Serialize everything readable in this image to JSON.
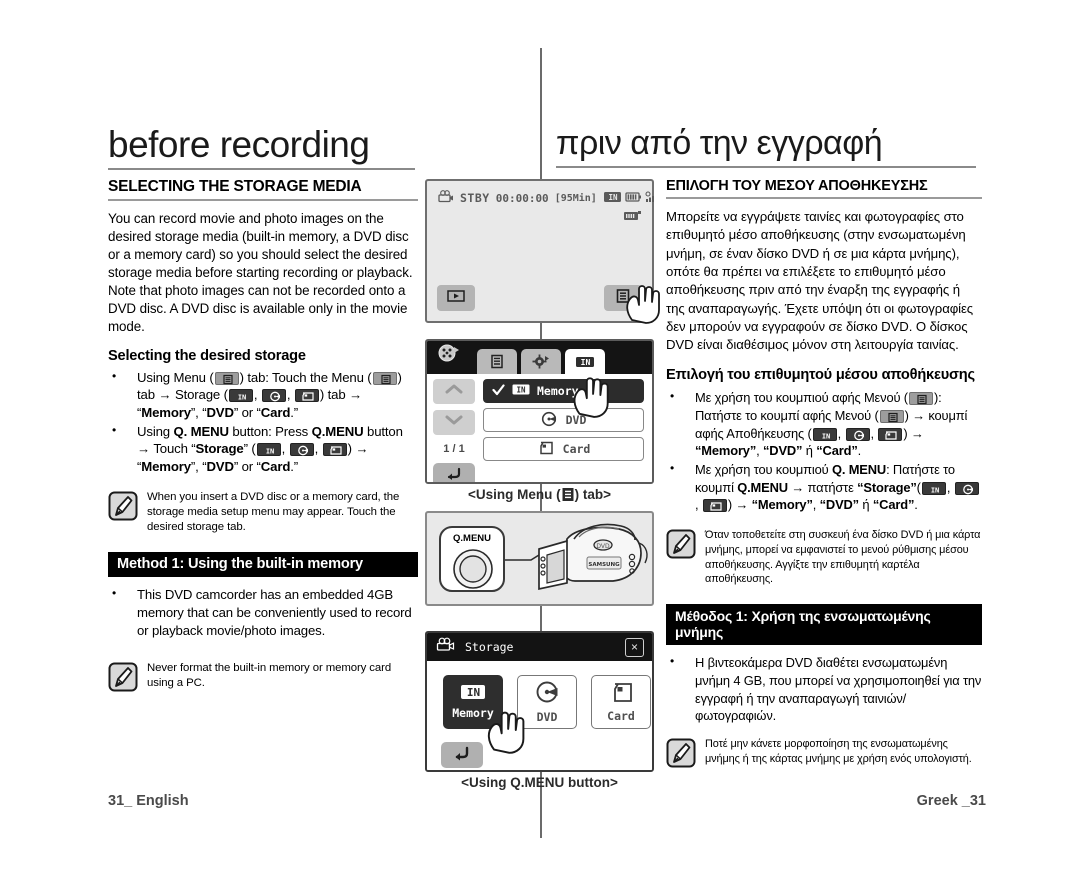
{
  "page": {
    "title_en": "before recording",
    "title_el": "πριν από την εγγραφή",
    "footer_left": "31_ English",
    "footer_right": "Greek _31"
  },
  "english": {
    "section_heading": "SELECTING THE STORAGE MEDIA",
    "intro": "You can record movie and photo images on the desired storage media (built-in memory, a DVD disc or a memory card) so you should select the desired storage media before starting recording or playback. Note that photo images can not be recorded onto a DVD disc. A DVD disc is available only in the movie mode.",
    "sub_heading": "Selecting the desired storage",
    "bullet1": {
      "p1": "Using Menu (",
      "p2": ") tab: Touch the Menu (",
      "p3": ") tab → Storage (",
      "p4": ") tab → “",
      "b_memory": "Memory",
      "p5": "”, “",
      "b_dvd": "DVD",
      "p6": "” or “",
      "b_card": "Card",
      "p7": ".”"
    },
    "bullet2": {
      "p1": "Using ",
      "b_qmenu1": "Q. MENU",
      "p2": " button: Press ",
      "b_qmenu2": "Q.MENU",
      "p3": " button → Touch “",
      "b_storage": "Storage",
      "p4": "” (",
      "p5": ") → “",
      "b_memory": "Memory",
      "p6": "”, “",
      "b_dvd": "DVD",
      "p7": "” or “",
      "b_card": "Card",
      "p8": ".”"
    },
    "note1": "When you insert a DVD disc or a memory card, the storage media setup menu may appear. Touch the desired storage tab.",
    "method_bar": "Method 1: Using the built-in memory",
    "method_bullet": "This DVD camcorder has an embedded 4GB memory that can be conveniently used to record or playback movie/photo images.",
    "note2": "Never format the built-in memory or memory card using a PC."
  },
  "greek": {
    "section_heading": "ΕΠΙΛΟΓΗ ΤΟΥ ΜΕΣΟΥ ΑΠΟΘΗΚΕΥΣΗΣ",
    "intro": "Μπορείτε να εγγράψετε ταινίες και φωτογραφίες στο επιθυμητό μέσο αποθήκευσης (στην ενσωματωμένη μνήμη, σε έναν δίσκο DVD ή σε μια κάρτα μνήμης), οπότε θα πρέπει να επιλέξετε το επιθυμητό μέσο αποθήκευσης πριν από την έναρξη της εγγραφής ή της αναπαραγωγής. Έχετε υπόψη ότι οι φωτογραφίες δεν μπορούν να εγγραφούν σε δίσκο DVD. Ο δίσκος DVD είναι διαθέσιμος μόνον στη λειτουργία ταινίας.",
    "sub_heading": "Επιλογή του επιθυμητού μέσου αποθήκευσης",
    "bullet1": {
      "p1": "Με χρήση του κουμπιού αφής Μενού (",
      "p2": "): Πατήστε το κουμπί αφής Μενού (",
      "p3": ") → κουμπί αφής Αποθήκευσης (",
      "p4": ") → ",
      "b_memory": "“Memory”",
      "p5": ", ",
      "b_dvd": "“DVD”",
      "p6": " ή ",
      "b_card": "“Card”",
      "p7": "."
    },
    "bullet2": {
      "p1": "Με χρήση του κουμπιού ",
      "b_qmenu1": "Q. MENU",
      "p2": ": Πατήστε το κουμπί ",
      "b_qmenu2": "Q.MENU",
      "p3": " → πατήστε ",
      "b_storage": "“Storage”",
      "p4": "(",
      "p5": ") → ",
      "b_memory": "“Memory”",
      "p6": ", ",
      "b_dvd": "“DVD”",
      "p7": " ή ",
      "b_card": "“Card”",
      "p8": "."
    },
    "note1": "Όταν τοποθετείτε στη συσκευή ένα δίσκο DVD ή μια κάρτα μνήμης, μπορεί να εμφανιστεί το μενού ρύθμισης μέσου αποθήκευσης. Αγγίξτε την επιθυμητή καρτέλα αποθήκευσης.",
    "method_bar": "Μέθοδος 1: Χρήση της ενσωματωμένης μνήμης",
    "method_bullet": "Η βιντεοκάμερα DVD διαθέτει ενσωματωμένη μνήμη 4 GB, που μπορεί να χρησιμοποιηθεί για την εγγραφή ή την αναπαραγωγή ταινιών/ φωτογραφιών.",
    "note2": "Ποτέ μην κάνετε μορφοποίηση της ενσωματωμένης μνήμης ή της κάρτας μνήμης με χρήση ενός υπολογιστή."
  },
  "figures": {
    "lcd_standby": {
      "mode_icon": "movie-camera-icon",
      "status": "STBY",
      "timecode": "00:00:00",
      "remaining": "[95Min]",
      "storage_icon": "in-memory-icon",
      "battery_icon": "battery-icon",
      "signal_icon": "signal-icon",
      "tape_icon": "tape-icon",
      "play_button_icon": "play-icon",
      "menu_button_icon": "menu-icon"
    },
    "menu_panel": {
      "tabs": [
        "settings-logo-icon",
        "menu-tab-icon",
        "gear-tab-icon",
        "in-memory-tab-icon"
      ],
      "rows": [
        {
          "label": "Memory",
          "icon": "in-memory-icon",
          "selected": true,
          "check": "✓"
        },
        {
          "label": "DVD",
          "icon": "dvd-disc-icon",
          "selected": false
        },
        {
          "label": "Card",
          "icon": "memory-card-icon",
          "selected": false
        }
      ],
      "page_counter": "1 / 1",
      "up_icon": "chevron-up-icon",
      "down_icon": "chevron-down-icon",
      "back_icon": "back-arrow-icon"
    },
    "camcorder": {
      "callout_label": "Q.MENU",
      "brand": "SAMSUNG"
    },
    "storage_panel": {
      "title": "Storage",
      "title_icon": "movie-camera-icon",
      "close_icon": "×",
      "tiles": [
        {
          "label": "Memory",
          "icon": "in-memory-icon",
          "selected": true
        },
        {
          "label": "DVD",
          "icon": "dvd-disc-icon",
          "selected": false
        },
        {
          "label": "Card",
          "icon": "memory-card-icon",
          "selected": false
        }
      ],
      "back_icon": "back-arrow-icon"
    },
    "caption_menu_pre": "<Using Menu (",
    "caption_menu_post": ") tab>",
    "caption_qmenu": "<Using Q.MENU button>"
  }
}
